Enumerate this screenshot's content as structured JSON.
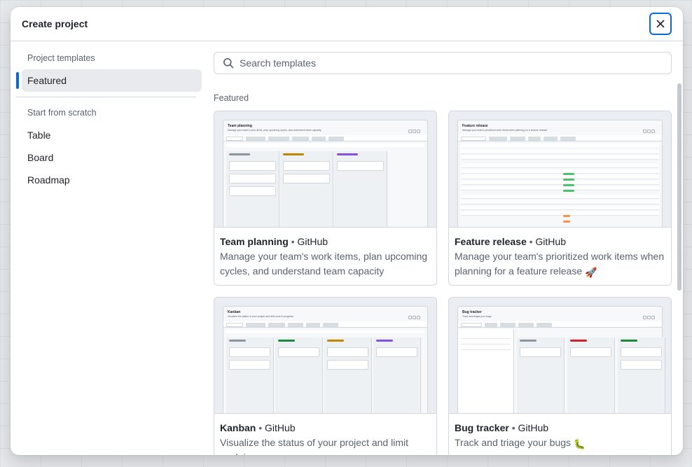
{
  "dialog": {
    "title": "Create project",
    "close_label": "Close"
  },
  "sidebar": {
    "templates_heading": "Project templates",
    "templates_items": [
      {
        "label": "Featured",
        "active": true
      }
    ],
    "scratch_heading": "Start from scratch",
    "scratch_items": [
      {
        "label": "Table"
      },
      {
        "label": "Board"
      },
      {
        "label": "Roadmap"
      }
    ]
  },
  "main": {
    "search": {
      "placeholder": "Search templates",
      "value": ""
    },
    "section_label": "Featured",
    "cards": [
      {
        "name": "Team planning",
        "separator": "•",
        "author": "GitHub",
        "description": "Manage your team's work items, plan upcoming cycles, and understand team capacity",
        "preview_title": "Team planning",
        "preview_subtitle": "Manage your team's work items, plan upcoming cycles, and understand team capacity"
      },
      {
        "name": "Feature release",
        "separator": "•",
        "author": "GitHub",
        "description": "Manage your team's prioritized work items when planning for a feature release",
        "emoji": "🚀",
        "preview_title": "Feature release",
        "preview_subtitle": "Manage your team's prioritized work items when planning for a feature release"
      },
      {
        "name": "Kanban",
        "separator": "•",
        "author": "GitHub",
        "description": "Visualize the status of your project and limit work in progress",
        "preview_title": "Kanban",
        "preview_subtitle": "Visualize the status of your project and limit work in progress"
      },
      {
        "name": "Bug tracker",
        "separator": "•",
        "author": "GitHub",
        "description": "Track and triage your bugs",
        "emoji": "🐛",
        "preview_title": "Bug tracker",
        "preview_subtitle": "Track and triage your bugs"
      }
    ]
  },
  "colors": {
    "accent": "#0969da",
    "muted_text": "#59636e",
    "border": "#d0d7de",
    "active_bg": "#e8eaed"
  },
  "icons": {
    "close": "x-icon",
    "search": "search-icon"
  }
}
